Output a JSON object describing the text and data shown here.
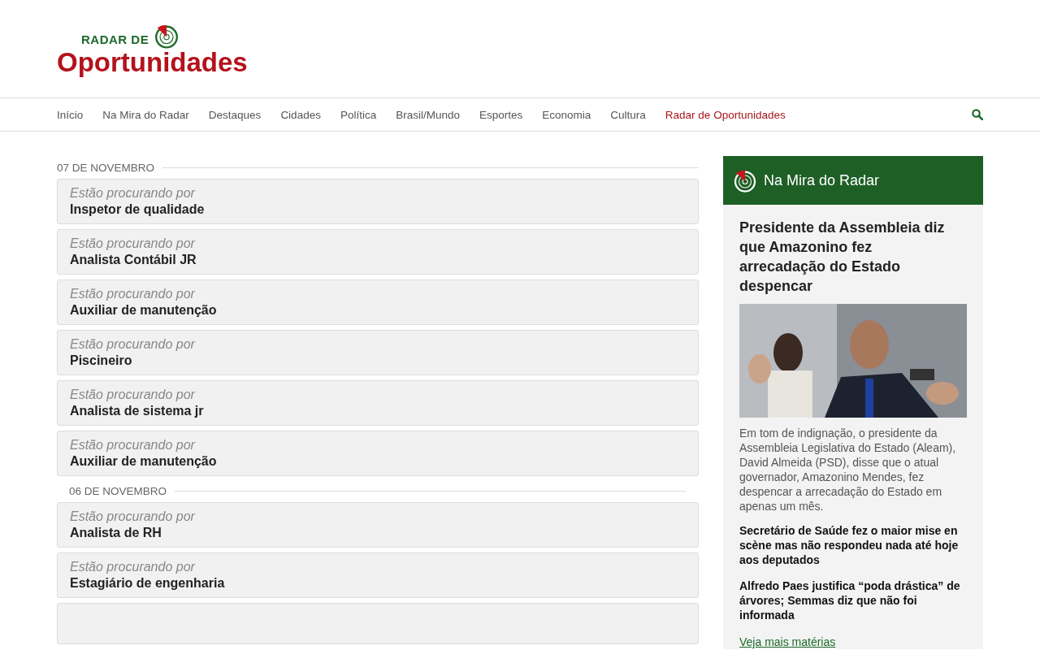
{
  "logo": {
    "top": "RADAR DE",
    "bottom": "Oportunidades"
  },
  "nav": [
    {
      "label": "Início",
      "selected": false
    },
    {
      "label": "Na Mira do Radar",
      "selected": false
    },
    {
      "label": "Destaques",
      "selected": false
    },
    {
      "label": "Cidades",
      "selected": false
    },
    {
      "label": "Política",
      "selected": false
    },
    {
      "label": "Brasil/Mundo",
      "selected": false
    },
    {
      "label": "Esportes",
      "selected": false
    },
    {
      "label": "Economia",
      "selected": false
    },
    {
      "label": "Cultura",
      "selected": false
    },
    {
      "label": "Radar de Oportunidades",
      "selected": true
    }
  ],
  "groups": [
    {
      "date": "07 DE NOVEMBRO",
      "jobs": [
        {
          "kind": "job",
          "kicker": "Estão procurando por",
          "title": "Inspetor de qualidade"
        },
        {
          "kind": "job",
          "kicker": "Estão procurando por",
          "title": "Analista Contábil JR"
        },
        {
          "kind": "job",
          "kicker": "Estão procurando por",
          "title": "Auxiliar de manutenção"
        },
        {
          "kind": "job",
          "kicker": "Estão procurando por",
          "title": "Piscineiro"
        },
        {
          "kind": "job",
          "kicker": "Estão procurando por",
          "title": "Analista de sistema jr"
        },
        {
          "kind": "job",
          "kicker": "Estão procurando por",
          "title": "Auxiliar de manutenção"
        }
      ]
    },
    {
      "date": "06 DE NOVEMBRO",
      "jobs": [
        {
          "kind": "job",
          "kicker": "Estão procurando por",
          "title": "Analista de RH"
        },
        {
          "kind": "job",
          "kicker": "Estão procurando por",
          "title": "Estagiário de engenharia"
        },
        {
          "kind": "cut"
        }
      ]
    }
  ],
  "sidebar": {
    "title": "Na Mira do Radar",
    "lead": {
      "headline": "Presidente da Assembleia diz que Amazonino fez arrecadação do Estado despencar",
      "summary": "Em tom de indignação, o presidente da Assembleia Legislativa do Estado (Aleam), David Almeida (PSD), disse que o atual governador, Amazonino Mendes, fez despencar a arrecadação do Estado em apenas um mês."
    },
    "links": [
      "Secretário de Saúde fez o maior mise en scène mas não respondeu nada até hoje aos deputados",
      "Alfredo Paes justifica “poda drástica” de árvores; Semmas diz que não foi informada"
    ],
    "more": "Veja mais matérias"
  }
}
